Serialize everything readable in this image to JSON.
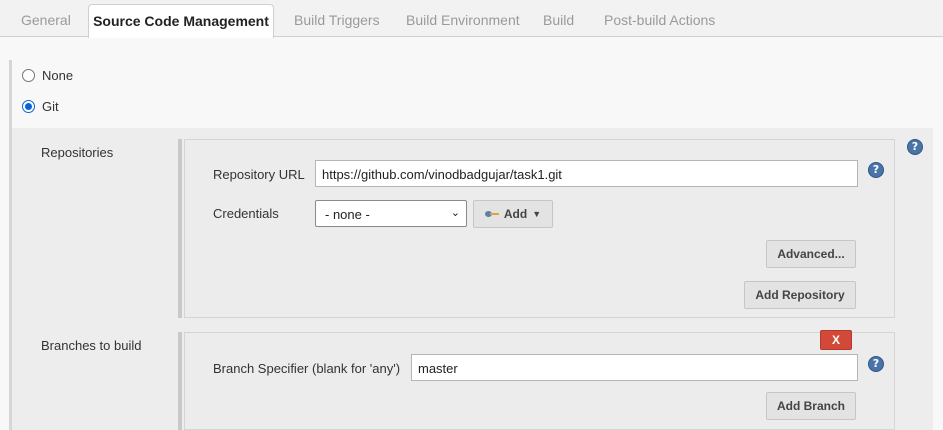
{
  "tabs": [
    {
      "label": "General",
      "active": false
    },
    {
      "label": "Source Code Management",
      "active": true
    },
    {
      "label": "Build Triggers",
      "active": false
    },
    {
      "label": "Build Environment",
      "active": false
    },
    {
      "label": "Build",
      "active": false
    },
    {
      "label": "Post-build Actions",
      "active": false
    }
  ],
  "scm": {
    "options": [
      {
        "label": "None",
        "selected": false
      },
      {
        "label": "Git",
        "selected": true
      }
    ]
  },
  "repositories": {
    "section_label": "Repositories",
    "url_label": "Repository URL",
    "url_value": "https://github.com/vinodbadgujar/task1.git",
    "credentials_label": "Credentials",
    "credentials_value": "- none -",
    "add_label": "Add",
    "advanced_label": "Advanced...",
    "add_repository_label": "Add Repository"
  },
  "branches": {
    "section_label": "Branches to build",
    "delete_label": "X",
    "specifier_label": "Branch Specifier (blank for 'any')",
    "specifier_value": "master",
    "add_branch_label": "Add Branch"
  },
  "help_glyph": "?",
  "colors": {
    "accent_blue": "#0a63d6",
    "delete_red": "#d24939",
    "help_blue": "#4a74a8"
  }
}
